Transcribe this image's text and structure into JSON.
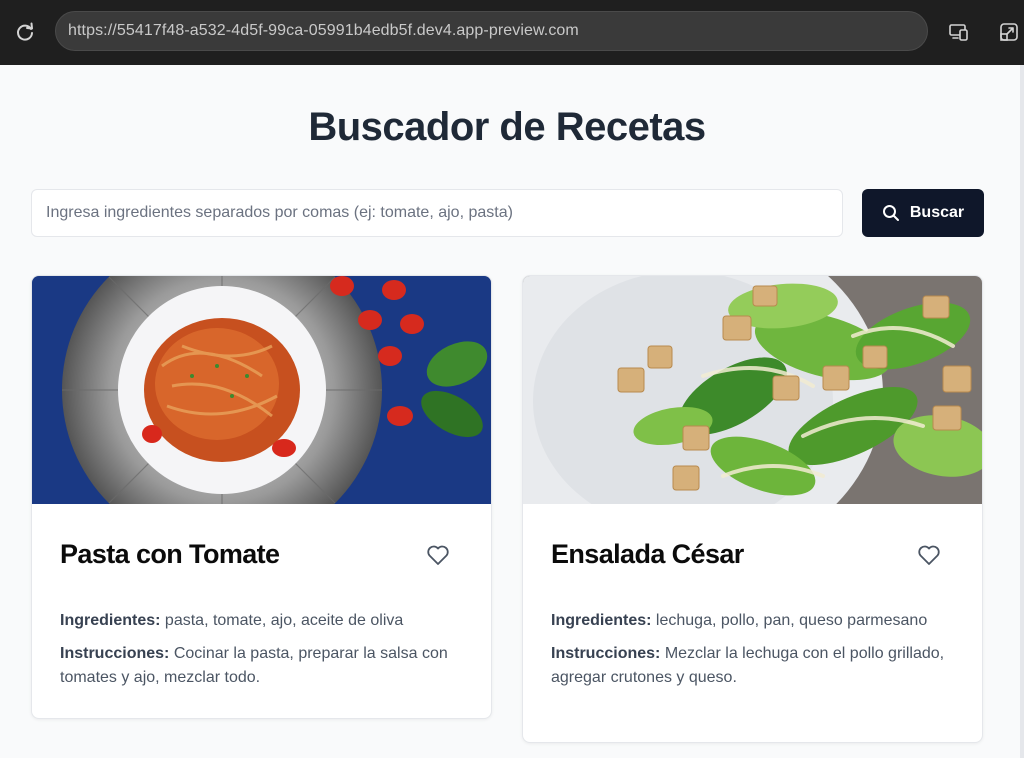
{
  "browser": {
    "url": "https://55417f48-a532-4d5f-99ca-05991b4edb5f.dev4.app-preview.com"
  },
  "header": {
    "title": "Buscador de Recetas"
  },
  "search": {
    "placeholder": "Ingresa ingredientes separados por comas (ej: tomate, ajo, pasta)",
    "value": "",
    "button_label": "Buscar"
  },
  "labels": {
    "ingredients": "Ingredientes:",
    "instructions": "Instrucciones:"
  },
  "recipes": [
    {
      "title": "Pasta con Tomate",
      "ingredients": "pasta, tomate, ajo, aceite de oliva",
      "instructions": "Cocinar la pasta, preparar la salsa con tomates y ajo, mezclar todo.",
      "image_icon": "pasta-photo"
    },
    {
      "title": "Ensalada César",
      "ingredients": "lechuga, pollo, pan, queso parmesano",
      "instructions": "Mezclar la lechuga con el pollo grillado, agregar crutones y queso.",
      "image_icon": "salad-photo"
    }
  ],
  "colors": {
    "primary_button": "#0f172a",
    "title_text": "#1f2937",
    "page_background": "#f9fafb",
    "chrome_background": "#1f1f1f"
  }
}
